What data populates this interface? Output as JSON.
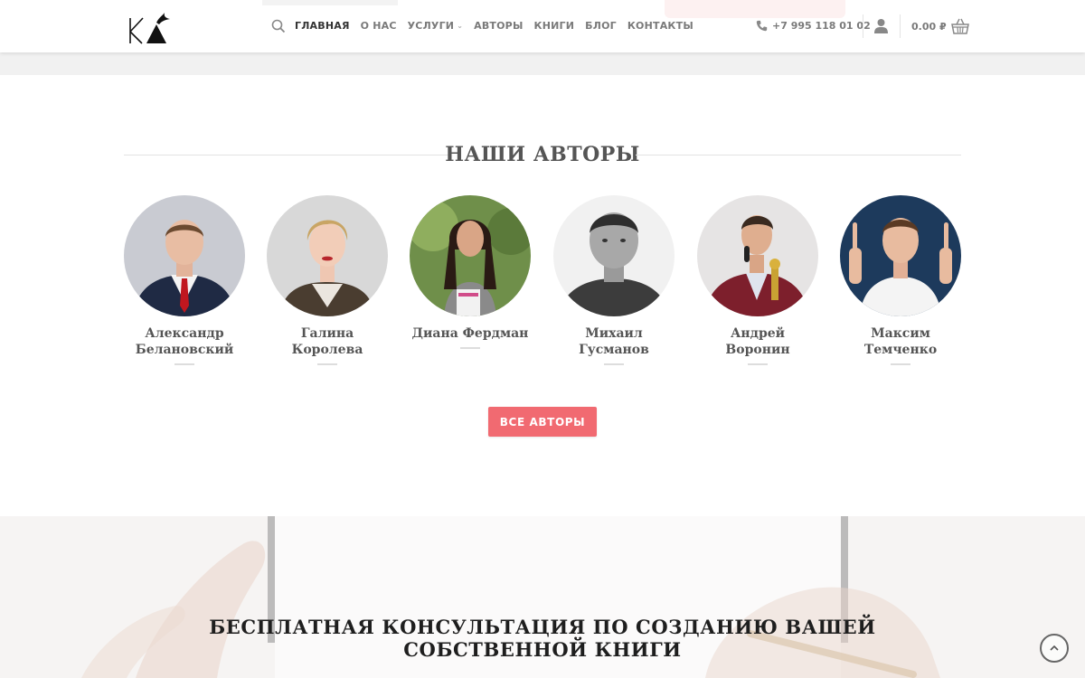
{
  "header": {
    "nav": [
      {
        "label": "ГЛАВНАЯ",
        "active": true
      },
      {
        "label": "О НАС"
      },
      {
        "label": "УСЛУГИ",
        "dropdown": true
      },
      {
        "label": "АВТОРЫ"
      },
      {
        "label": "КНИГИ"
      },
      {
        "label": "БЛОГ"
      },
      {
        "label": "КОНТАКТЫ"
      }
    ],
    "phone": "+7 995 118 01 02",
    "cart_total": "0.00 ₽",
    "icons": [
      "logo",
      "search-icon",
      "chevron-down-icon",
      "phone-icon",
      "user-icon",
      "basket-icon"
    ]
  },
  "authors_section": {
    "title": "НАШИ АВТОРЫ",
    "authors": [
      {
        "name": "Александр Белановский"
      },
      {
        "name": "Галина Королева"
      },
      {
        "name": "Диана Фердман"
      },
      {
        "name": "Михаил Гусманов"
      },
      {
        "name": "Андрей Воронин"
      },
      {
        "name": "Максим Темченко"
      }
    ],
    "all_button": "ВСЕ АВТОРЫ"
  },
  "hero": {
    "title": "БЕСПЛАТНАЯ КОНСУЛЬТАЦИЯ ПО СОЗДАНИЮ ВАШЕЙ СОБСТВЕННОЙ КНИГИ"
  },
  "colors": {
    "accent": "#f16a71",
    "heading": "#555555",
    "nav": "#7a7a7a"
  }
}
